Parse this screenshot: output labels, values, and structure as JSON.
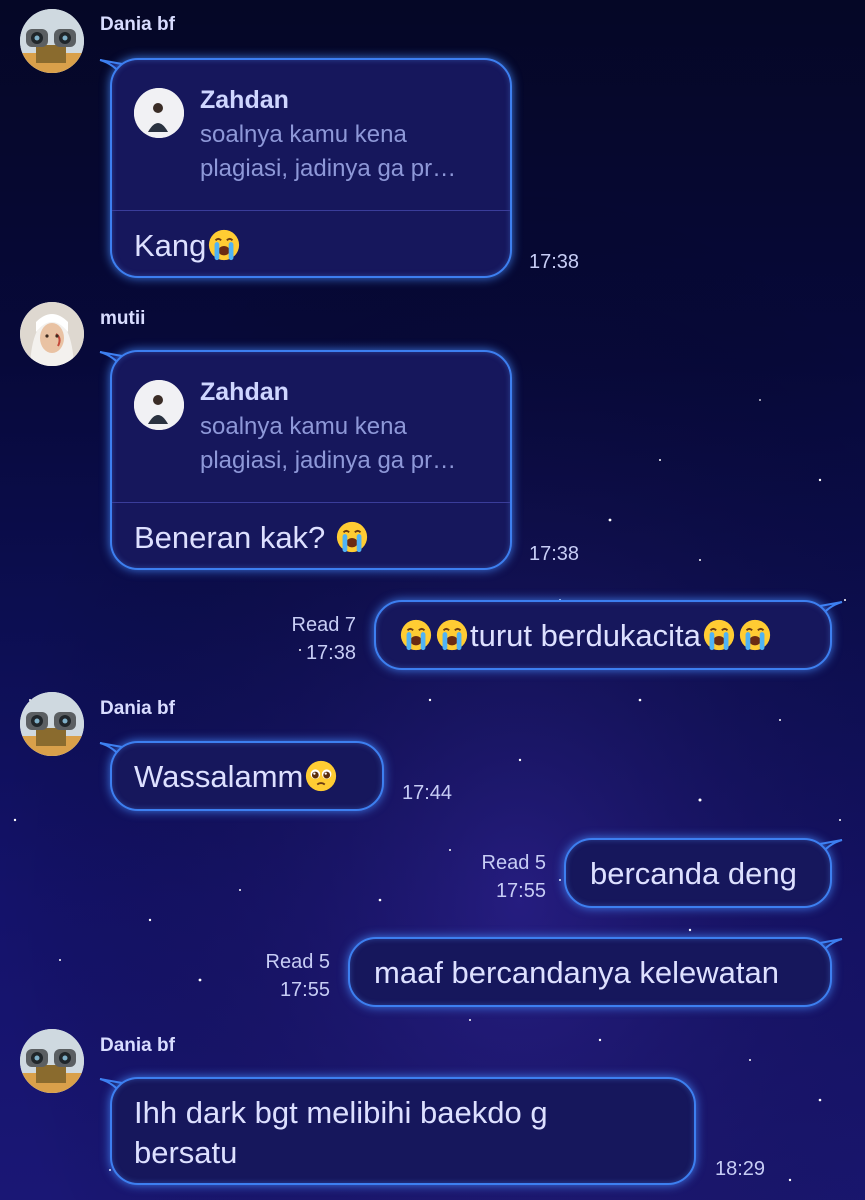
{
  "messages": [
    {
      "sender": "Dania bf",
      "reply_name": "Zahdan",
      "reply_text": "soalnya kamu kena plagiasi, jadinya ga pr…",
      "text": "Kang",
      "time": "17:38"
    },
    {
      "sender": "mutii",
      "reply_name": "Zahdan",
      "reply_text": "soalnya kamu kena plagiasi, jadinya ga pr…",
      "text": "Beneran kak? ",
      "time": "17:38"
    },
    {
      "text": "turut berdukacita",
      "read": "Read 7",
      "time": "17:38"
    },
    {
      "sender": "Dania bf",
      "text": "Wassalamm",
      "time": "17:44"
    },
    {
      "text": "bercanda deng",
      "read": "Read 5",
      "time": "17:55"
    },
    {
      "text": "maaf bercandanya kelewatan",
      "read": "Read 5",
      "time": "17:55"
    },
    {
      "sender": "Dania bf",
      "text": "Ihh dark bgt melibihi baekdo g bersatu",
      "time": "18:29"
    }
  ],
  "icons": {
    "cry": "loudly-crying-face-emoji",
    "plead": "pleading-face-emoji"
  },
  "colors": {
    "bubble": "#16175c",
    "border": "#3d7ff0",
    "text": "#dde0ff"
  }
}
